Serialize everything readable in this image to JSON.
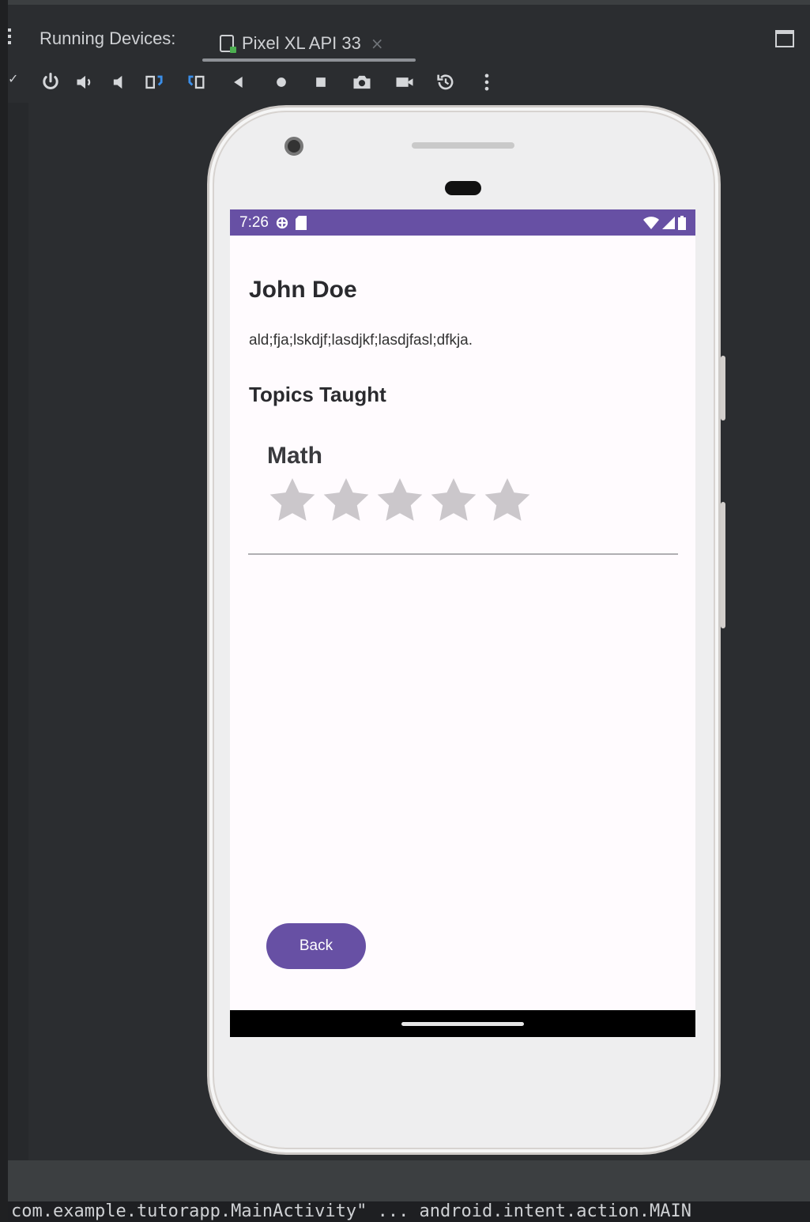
{
  "ide": {
    "panel_title": "Running Devices:",
    "device_tab_label": "Pixel XL API 33",
    "close_glyph": "×",
    "console_text": "com.example.tutorapp.MainActivity\" ... android.intent.action.MAIN"
  },
  "toolbar_icons": [
    "power-icon",
    "volume-up-icon",
    "volume-down-icon",
    "rotate-left-icon",
    "rotate-right-icon",
    "back-icon",
    "home-icon",
    "overview-icon",
    "screenshot-icon",
    "screen-record-icon",
    "snapshot-icon",
    "more-options-icon"
  ],
  "status_bar": {
    "time": "7:26",
    "color": "#6750a4"
  },
  "app": {
    "tutor_name": "John Doe",
    "tutor_bio": "ald;fja;lskdjf;lasdjkf;lasdjfasl;dfkja.",
    "topics_heading": "Topics Taught",
    "topics": [
      {
        "name": "Math",
        "rating": 0,
        "max_rating": 5
      }
    ],
    "back_button_label": "Back",
    "accent_color": "#6750a4"
  }
}
